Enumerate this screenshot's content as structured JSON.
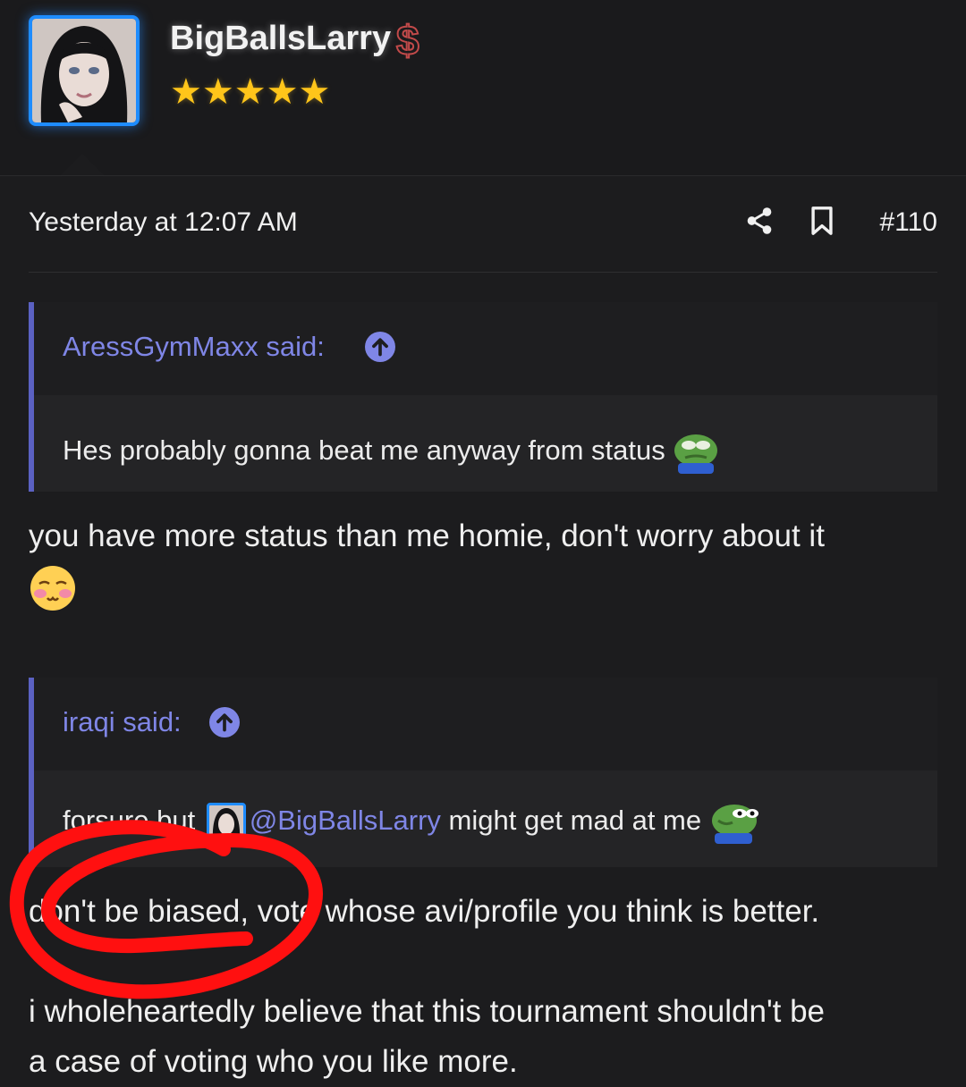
{
  "post": {
    "username": "BigBallsLarry",
    "badge_symbol": "$",
    "rating": 5,
    "stars_text": "★★★★★",
    "timestamp": "Yesterday at 12:07 AM",
    "post_number": "#110"
  },
  "quotes": [
    {
      "author_label": "AressGymMaxx said:",
      "text": "Hes probably gonna beat me anyway from status"
    },
    {
      "author_label": "iraqi said:",
      "text_prefix": "forsure but",
      "mention": "@BigBallsLarry",
      "text_suffix": " might get mad at me"
    }
  ],
  "replies": {
    "reply1": "you have more status than me homie, don't worry about it",
    "reply2": "don't be biased, vote whose avi/profile you think is better.",
    "reply3_line1": "i wholeheartedly believe that this tournament shouldn't be",
    "reply3_line2": "a case of voting who you like more."
  },
  "colors": {
    "background": "#1c1c1e",
    "accent_blue": "#1e8cff",
    "quote_bar": "#5b61c2",
    "mention": "#7f86e6",
    "star": "#ffc51a",
    "annotation_red": "#ff0000"
  },
  "icons": [
    "share-icon",
    "bookmark-icon",
    "expand-arrow-icon",
    "pepe-sad-emoji",
    "blush-emoji",
    "pepe-smirk-emoji"
  ]
}
